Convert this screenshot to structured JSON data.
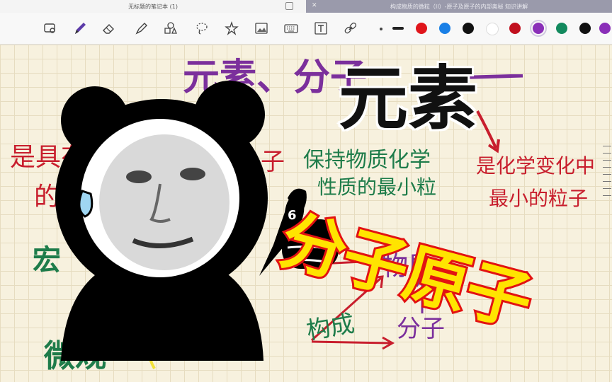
{
  "window": {
    "left_title": "无标题的笔记本 (1)",
    "right_title": "构成物质的微粒（II）-原子及原子的内部奥秘 知识讲解"
  },
  "toolbar": {
    "tools": [
      "lasso-icon",
      "pen-icon",
      "eraser-icon",
      "highlighter-icon",
      "shapes-icon",
      "lasso-select-icon",
      "sticker-icon",
      "image-icon",
      "keyboard-icon",
      "textbox-icon",
      "link-icon"
    ],
    "colors": [
      "#e0151b",
      "#1a7fe6",
      "#111111",
      "#ffffff",
      "#c1101e",
      "#8a2fb8",
      "#138a5e",
      "#111111",
      "#8a2fb8"
    ],
    "selected_color": "#8a2fb8"
  },
  "notes": {
    "n1": "元素、分子",
    "n2": "是具有",
    "n3": "的",
    "n4": "子",
    "n5": "保持物质化学",
    "n6": "性质的最小粒",
    "n7": "是化学变化中",
    "n8": "最小的粒子",
    "n9": "宏",
    "n10": "物质",
    "n11": "构成",
    "n12": "分子",
    "n13": "微观",
    "n14": "原"
  },
  "overlay": {
    "title": "元素",
    "subtitle": "分子原子",
    "meme_caption": "6"
  }
}
